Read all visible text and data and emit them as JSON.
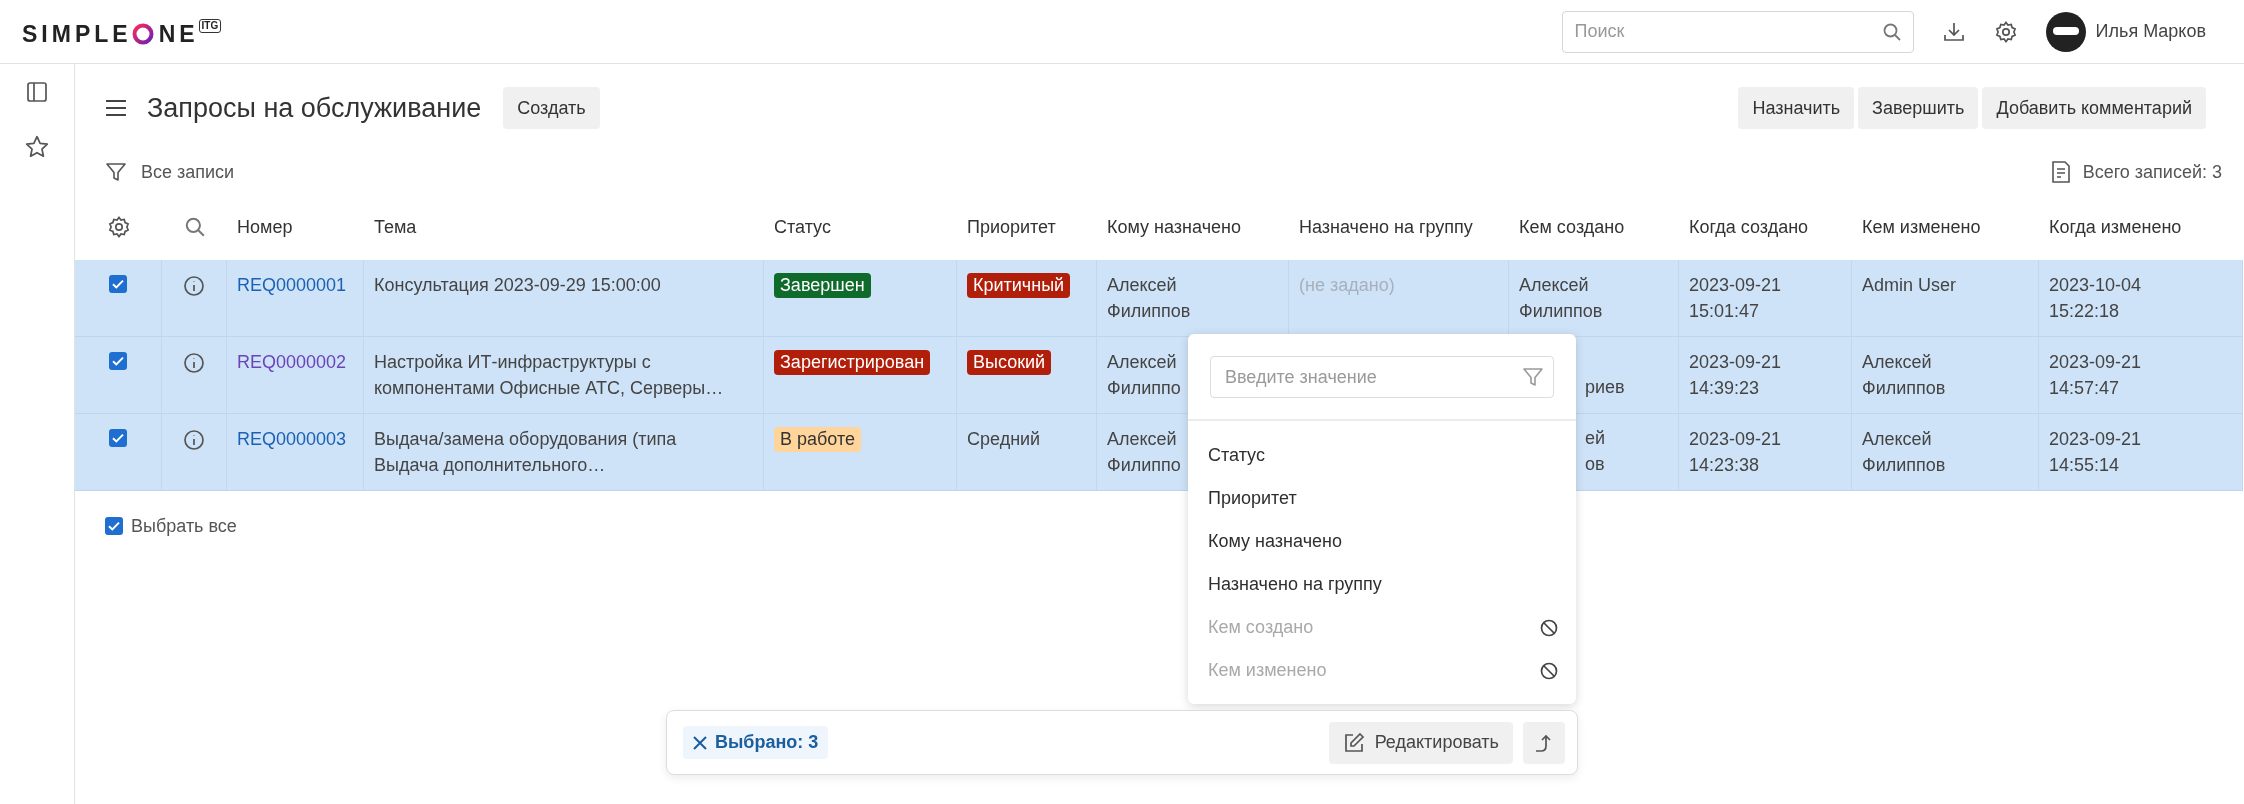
{
  "header": {
    "logo": {
      "text_start": "SIMPLE",
      "text_end": "NE",
      "badge": "ITG"
    },
    "search": {
      "placeholder": "Поиск"
    },
    "user": {
      "name": "Илья Марков"
    }
  },
  "page": {
    "title": "Запросы на обслуживание",
    "create_button": "Создать",
    "actions": [
      "Назначить",
      "Завершить",
      "Добавить комментарий"
    ]
  },
  "filter": {
    "label": "Все записи",
    "total": "Всего записей: 3"
  },
  "table": {
    "columns": [
      "Номер",
      "Тема",
      "Статус",
      "Приоритет",
      "Кому назначено",
      "Назначено на группу",
      "Кем создано",
      "Когда создано",
      "Кем изменено",
      "Когда изменено"
    ],
    "rows": [
      {
        "selected": true,
        "checked": true,
        "cells": [
          {
            "kind": "link",
            "text": "REQ0000001",
            "visited": false
          },
          {
            "kind": "text",
            "text": "Консультация 2023-09-29 15:00:00",
            "muted": false
          },
          {
            "kind": "badge",
            "text": "Завершен",
            "color": "#0e6b2c"
          },
          {
            "kind": "badge",
            "text": "Критичный",
            "color": "#b11f0b"
          },
          {
            "kind": "text",
            "text": "Алексей\nФилиппов",
            "muted": false
          },
          {
            "kind": "text",
            "text": "(не задано)",
            "muted": true
          },
          {
            "kind": "text",
            "text": "Алексей\nФилиппов",
            "muted": false
          },
          {
            "kind": "text",
            "text": "2023-09-21\n15:01:47",
            "muted": false
          },
          {
            "kind": "text",
            "text": "Admin User",
            "muted": false
          },
          {
            "kind": "text",
            "text": "2023-10-04\n15:22:18",
            "muted": false
          }
        ]
      },
      {
        "selected": true,
        "checked": true,
        "cells": [
          {
            "kind": "link",
            "text": "REQ0000002",
            "visited": true
          },
          {
            "kind": "text",
            "text": "Настройка ИТ-инфраструктуры с\nкомпонентами Офисные АТС, Серверы…",
            "muted": false
          },
          {
            "kind": "badge",
            "text": "Зарегистрирован",
            "color": "#b11f0b"
          },
          {
            "kind": "badge",
            "text": "Высокий",
            "color": "#b11f0b"
          },
          {
            "kind": "text",
            "text": "Алексей\nФилиппо",
            "muted": false
          },
          null,
          {
            "kind": "partial",
            "text": "риев"
          },
          {
            "kind": "text",
            "text": "2023-09-21\n14:39:23",
            "muted": false
          },
          {
            "kind": "text",
            "text": "Алексей\nФилиппов",
            "muted": false
          },
          {
            "kind": "text",
            "text": "2023-09-21\n14:57:47",
            "muted": false
          }
        ]
      },
      {
        "selected": true,
        "checked": true,
        "cells": [
          {
            "kind": "link",
            "text": "REQ0000003",
            "visited": false
          },
          {
            "kind": "text",
            "text": "Выдача/замена оборудования (типа\nВыдача дополнительного…",
            "muted": false
          },
          {
            "kind": "badge",
            "text": "В работе",
            "color": "#ffd59c"
          },
          {
            "kind": "text",
            "text": "Средний",
            "muted": false
          },
          {
            "kind": "text",
            "text": "Алексей\nФилиппо",
            "muted": false
          },
          null,
          {
            "kind": "partial",
            "text": "ей\nов"
          },
          {
            "kind": "text",
            "text": "2023-09-21\n14:23:38",
            "muted": false
          },
          {
            "kind": "text",
            "text": "Алексей\nФилиппов",
            "muted": false
          },
          {
            "kind": "text",
            "text": "2023-09-21\n14:55:14",
            "muted": false
          }
        ]
      }
    ]
  },
  "select_all": {
    "label": "Выбрать все",
    "checked": true
  },
  "column_menu": {
    "placeholder": "Введите значение",
    "items": [
      {
        "label": "Статус",
        "disabled": false
      },
      {
        "label": "Приоритет",
        "disabled": false
      },
      {
        "label": "Кому назначено",
        "disabled": false
      },
      {
        "label": "Назначено на группу",
        "disabled": false
      },
      {
        "label": "Кем создано",
        "disabled": true
      },
      {
        "label": "Кем изменено",
        "disabled": true
      }
    ]
  },
  "action_bar": {
    "selected": "Выбрано: 3",
    "edit_button": "Редактировать"
  }
}
